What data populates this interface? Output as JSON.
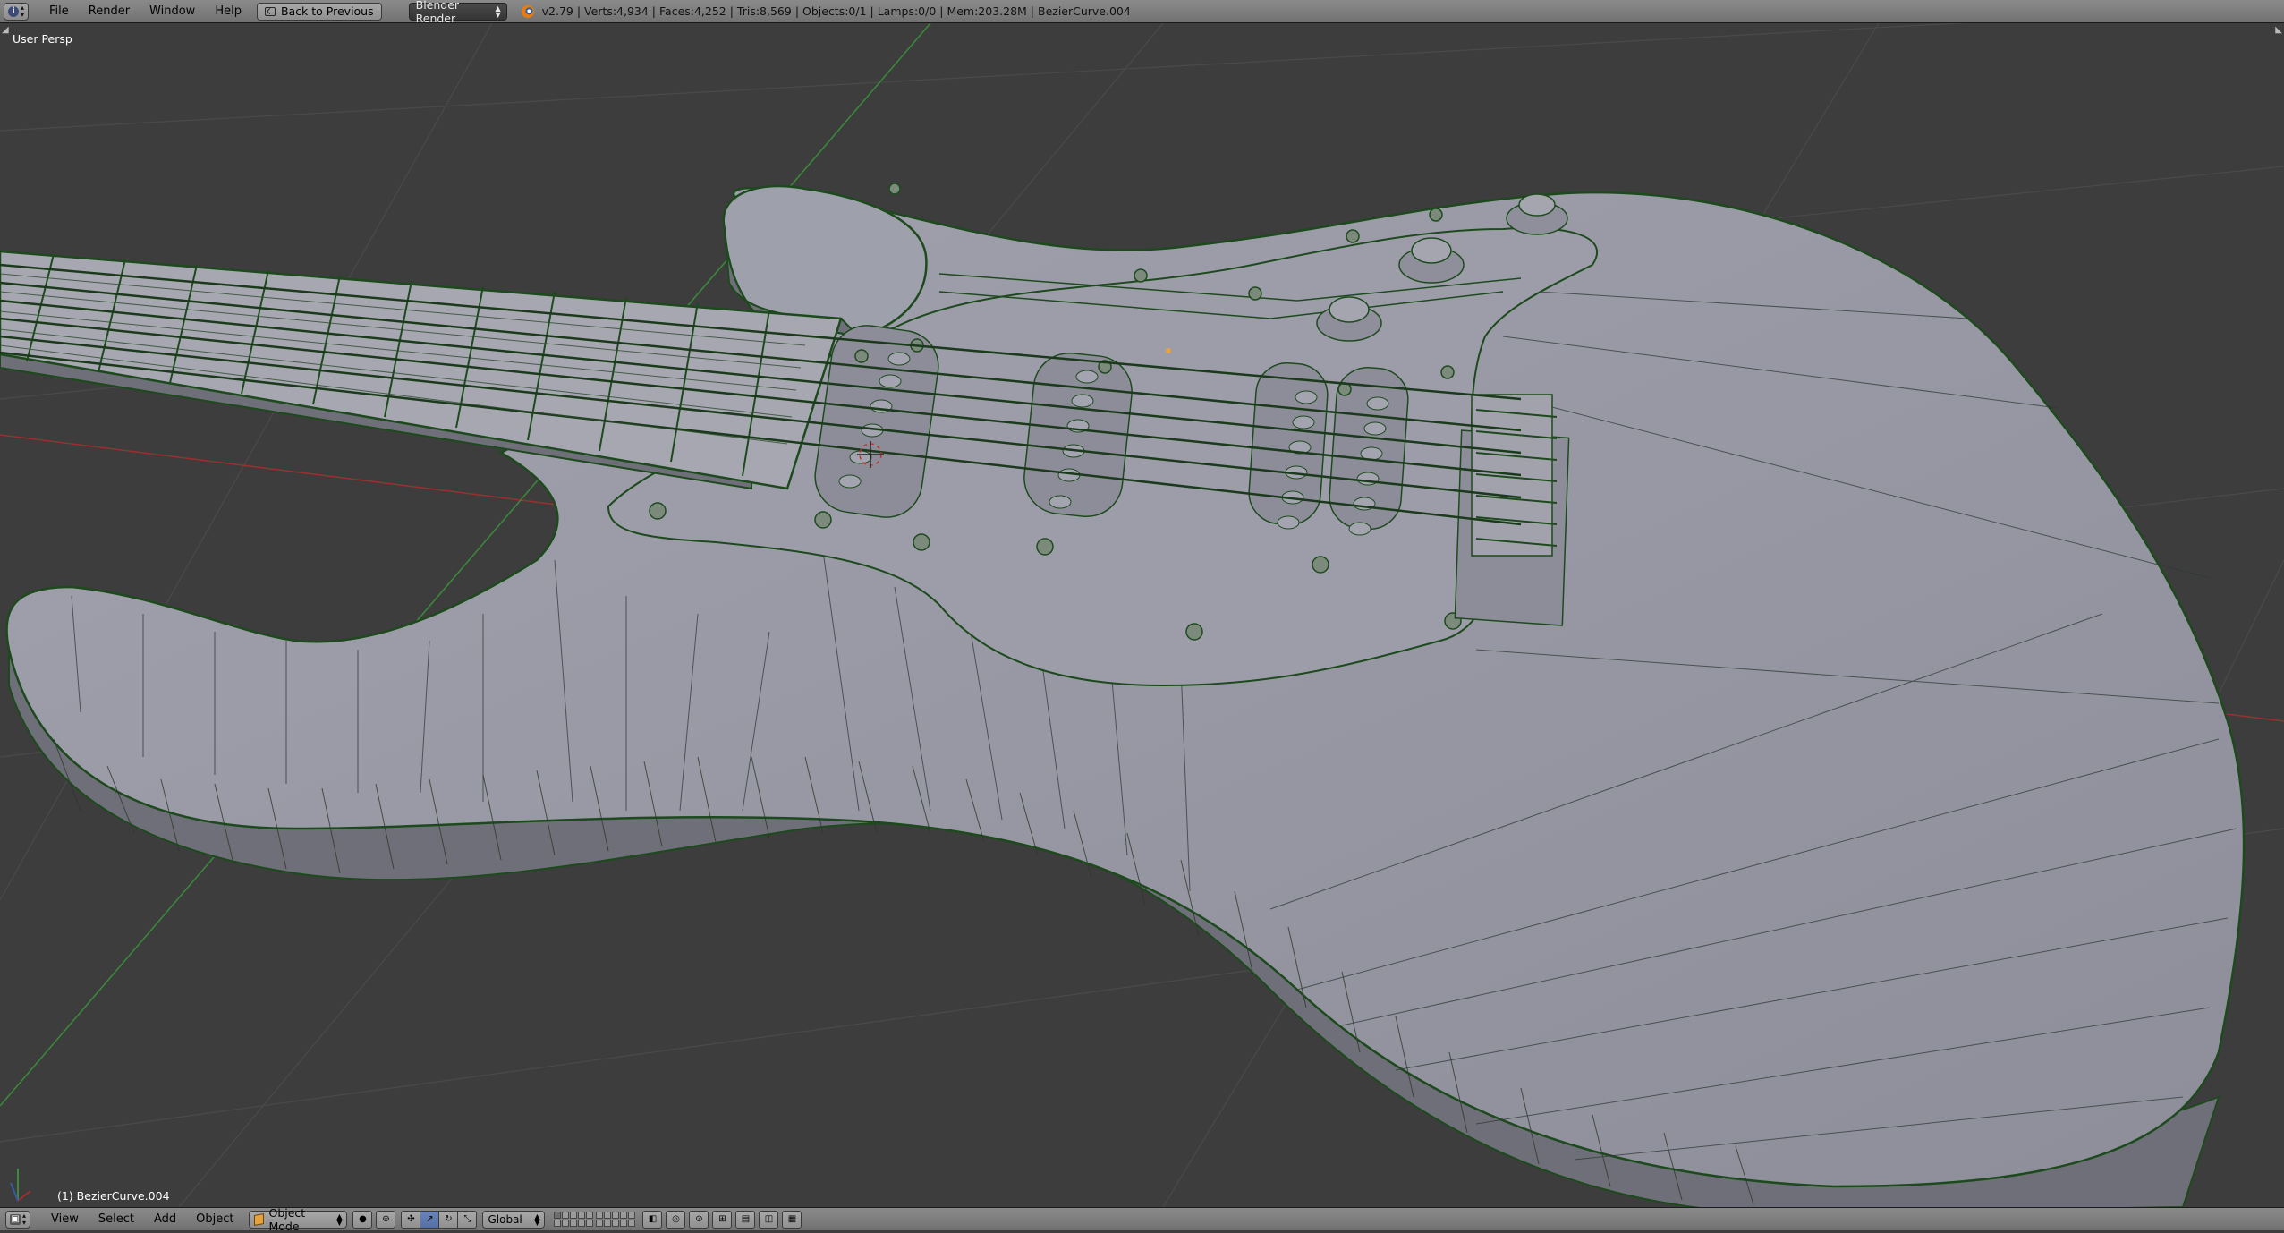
{
  "info_header": {
    "editor_type_icon": "info-icon",
    "menus": [
      "File",
      "Render",
      "Window",
      "Help"
    ],
    "back_button": "Back to Previous",
    "render_engine": "Blender Render",
    "stats": "v2.79 | Verts:4,934 | Faces:4,252 | Tris:8,569 | Objects:0/1 | Lamps:0/0 | Mem:203.28M | BezierCurve.004"
  },
  "viewport": {
    "view_label": "User Persp",
    "object_label": "(1) BezierCurve.004",
    "colors": {
      "background": "#3d3d3d",
      "body_fill": "#9a9aa6",
      "side_fill": "#6f6f79",
      "wire": "#1d4a1d",
      "grid": "#4a4a4a",
      "x_axis": "#9a3030",
      "y_axis": "#3b8a3b"
    }
  },
  "view3d_header": {
    "editor_type_icon": "view3d-icon",
    "menus": [
      "View",
      "Select",
      "Add",
      "Object"
    ],
    "mode": "Object Mode",
    "mode_icon": "cube-icon",
    "shading_icon": "solid-sphere-icon",
    "pivot_icon": "pivot-icon",
    "manipulator_icons": [
      "manipulator-toggle-icon",
      "translate-icon",
      "rotate-icon",
      "scale-icon"
    ],
    "orientation": "Global",
    "layers_active": [
      0
    ],
    "extra_icons": [
      "snap-icon",
      "proportional-icon",
      "render-preview-icon",
      "opengl-render-icon",
      "opengl-anim-icon"
    ]
  }
}
